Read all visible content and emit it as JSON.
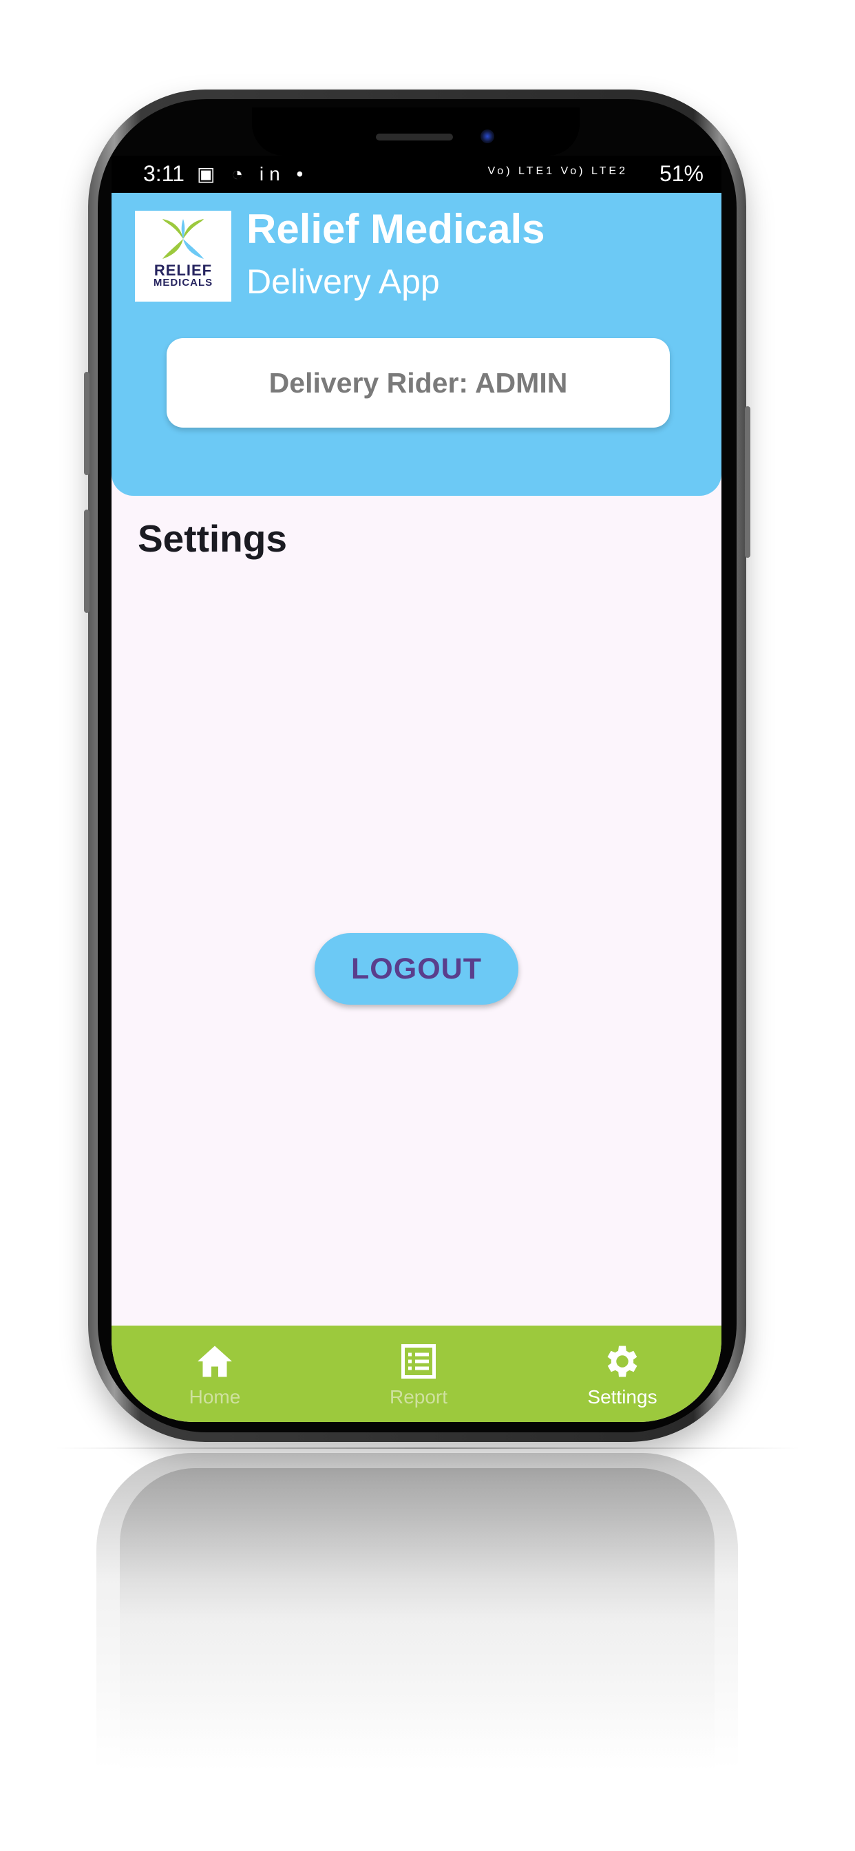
{
  "status_bar": {
    "time": "3:11",
    "left_icons": "▣ ◔ in •",
    "signal_text": "Vo) LTE1 Vo) LTE2",
    "battery": "51%"
  },
  "header": {
    "logo_line1": "RELIEF",
    "logo_line2": "MEDICALS",
    "title": "Relief Medicals",
    "subtitle": "Delivery App",
    "rider_card": "Delivery Rider: ADMIN"
  },
  "main": {
    "page_title": "Settings",
    "logout_label": "LOGOUT"
  },
  "bottom_nav": {
    "items": [
      {
        "label": "Home",
        "icon": "home-icon",
        "active": false
      },
      {
        "label": "Report",
        "icon": "list-icon",
        "active": false
      },
      {
        "label": "Settings",
        "icon": "gear-icon",
        "active": true
      }
    ]
  },
  "colors": {
    "header_bg": "#6cc9f5",
    "screen_bg": "#fcf5fc",
    "nav_bg": "#9cc93d",
    "logout_text": "#5a3e8c"
  }
}
